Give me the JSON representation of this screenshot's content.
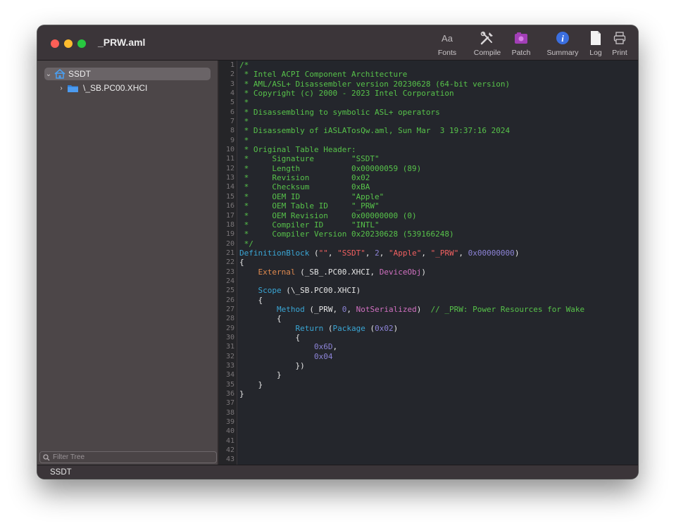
{
  "window": {
    "title": "_PRW.aml"
  },
  "toolbar": [
    {
      "label": "Fonts",
      "icon": "fonts-icon"
    },
    {
      "label": "Compile",
      "icon": "compile-tools-icon"
    },
    {
      "label": "Patch",
      "icon": "patch-icon"
    },
    {
      "label": "Summary",
      "icon": "info-icon"
    },
    {
      "label": "Log",
      "icon": "log-document-icon"
    },
    {
      "label": "Print",
      "icon": "printer-icon"
    }
  ],
  "fonts_icon_text": "Aa",
  "sidebar": {
    "tree": [
      {
        "label": "SSDT",
        "icon": "house-icon",
        "expanded": true,
        "selected": true
      },
      {
        "label": "\\_SB.PC00.XHCI",
        "icon": "folder-icon",
        "expanded": false,
        "selected": false
      }
    ],
    "filter_placeholder": "Filter Tree"
  },
  "status": {
    "text": "SSDT"
  },
  "colors": {
    "comment": "#57c24a",
    "keyword": "#3aa6d5",
    "string": "#f06060",
    "number": "#8c83d6",
    "external": "#e08a4f",
    "object": "#d070c0"
  },
  "editor": {
    "line_numbers": [
      "1",
      "2",
      "3",
      "4",
      "5",
      "6",
      "7",
      "8",
      "9",
      "10",
      "11",
      "12",
      "13",
      "14",
      "15",
      "16",
      "17",
      "18",
      "19",
      "20",
      "21",
      "22",
      "23",
      "24",
      "25",
      "26",
      "27",
      "28",
      "29",
      "30",
      "31",
      "32",
      "33",
      "34",
      "35",
      "36",
      "37",
      "38",
      "39",
      "40",
      "41",
      "42",
      "43"
    ],
    "lines": [
      [
        {
          "t": "/*",
          "c": "comment"
        }
      ],
      [
        {
          "t": " * Intel ACPI Component Architecture",
          "c": "comment"
        }
      ],
      [
        {
          "t": " * AML/ASL+ Disassembler version 20230628 (64-bit version)",
          "c": "comment"
        }
      ],
      [
        {
          "t": " * Copyright (c) 2000 - 2023 Intel Corporation",
          "c": "comment"
        }
      ],
      [
        {
          "t": " *",
          "c": "comment"
        }
      ],
      [
        {
          "t": " * Disassembling to symbolic ASL+ operators",
          "c": "comment"
        }
      ],
      [
        {
          "t": " *",
          "c": "comment"
        }
      ],
      [
        {
          "t": " * Disassembly of iASLATosQw.aml, Sun Mar  3 19:37:16 2024",
          "c": "comment"
        }
      ],
      [
        {
          "t": " *",
          "c": "comment"
        }
      ],
      [
        {
          "t": " * Original Table Header:",
          "c": "comment"
        }
      ],
      [
        {
          "t": " *     Signature        \"SSDT\"",
          "c": "comment"
        }
      ],
      [
        {
          "t": " *     Length           0x00000059 (89)",
          "c": "comment"
        }
      ],
      [
        {
          "t": " *     Revision         0x02",
          "c": "comment"
        }
      ],
      [
        {
          "t": " *     Checksum         0xBA",
          "c": "comment"
        }
      ],
      [
        {
          "t": " *     OEM ID           \"Apple\"",
          "c": "comment"
        }
      ],
      [
        {
          "t": " *     OEM Table ID     \"_PRW\"",
          "c": "comment"
        }
      ],
      [
        {
          "t": " *     OEM Revision     0x00000000 (0)",
          "c": "comment"
        }
      ],
      [
        {
          "t": " *     Compiler ID      \"INTL\"",
          "c": "comment"
        }
      ],
      [
        {
          "t": " *     Compiler Version 0x20230628 (539166248)",
          "c": "comment"
        }
      ],
      [
        {
          "t": " */",
          "c": "comment"
        }
      ],
      [
        {
          "t": "DefinitionBlock",
          "c": "kw"
        },
        {
          "t": " (",
          "c": "plain"
        },
        {
          "t": "\"\"",
          "c": "str"
        },
        {
          "t": ", ",
          "c": "plain"
        },
        {
          "t": "\"SSDT\"",
          "c": "str"
        },
        {
          "t": ", ",
          "c": "plain"
        },
        {
          "t": "2",
          "c": "num"
        },
        {
          "t": ", ",
          "c": "plain"
        },
        {
          "t": "\"Apple\"",
          "c": "str"
        },
        {
          "t": ", ",
          "c": "plain"
        },
        {
          "t": "\"_PRW\"",
          "c": "str"
        },
        {
          "t": ", ",
          "c": "plain"
        },
        {
          "t": "0x00000000",
          "c": "num"
        },
        {
          "t": ")",
          "c": "plain"
        }
      ],
      [
        {
          "t": "{",
          "c": "plain"
        }
      ],
      [
        {
          "t": "    ",
          "c": "plain"
        },
        {
          "t": "External",
          "c": "ext"
        },
        {
          "t": " (_SB_.PC00.XHCI, ",
          "c": "plain"
        },
        {
          "t": "DeviceObj",
          "c": "pink"
        },
        {
          "t": ")",
          "c": "plain"
        }
      ],
      [
        {
          "t": "",
          "c": "plain"
        }
      ],
      [
        {
          "t": "    ",
          "c": "plain"
        },
        {
          "t": "Scope",
          "c": "kw"
        },
        {
          "t": " (\\_SB.PC00.XHCI)",
          "c": "plain"
        }
      ],
      [
        {
          "t": "    {",
          "c": "plain"
        }
      ],
      [
        {
          "t": "        ",
          "c": "plain"
        },
        {
          "t": "Method",
          "c": "kw"
        },
        {
          "t": " (_PRW, ",
          "c": "plain"
        },
        {
          "t": "0",
          "c": "num"
        },
        {
          "t": ", ",
          "c": "plain"
        },
        {
          "t": "NotSerialized",
          "c": "pink"
        },
        {
          "t": ")  ",
          "c": "plain"
        },
        {
          "t": "// _PRW: Power Resources for Wake",
          "c": "comment"
        }
      ],
      [
        {
          "t": "        {",
          "c": "plain"
        }
      ],
      [
        {
          "t": "            ",
          "c": "plain"
        },
        {
          "t": "Return",
          "c": "kw"
        },
        {
          "t": " (",
          "c": "plain"
        },
        {
          "t": "Package",
          "c": "kw"
        },
        {
          "t": " (",
          "c": "plain"
        },
        {
          "t": "0x02",
          "c": "num"
        },
        {
          "t": ")",
          "c": "plain"
        }
      ],
      [
        {
          "t": "            {",
          "c": "plain"
        }
      ],
      [
        {
          "t": "                ",
          "c": "plain"
        },
        {
          "t": "0x6D",
          "c": "num"
        },
        {
          "t": ",",
          "c": "plain"
        }
      ],
      [
        {
          "t": "                ",
          "c": "plain"
        },
        {
          "t": "0x04",
          "c": "num"
        }
      ],
      [
        {
          "t": "            })",
          "c": "plain"
        }
      ],
      [
        {
          "t": "        }",
          "c": "plain"
        }
      ],
      [
        {
          "t": "    }",
          "c": "plain"
        }
      ],
      [
        {
          "t": "}",
          "c": "plain"
        }
      ],
      [
        {
          "t": "",
          "c": "plain"
        }
      ],
      [
        {
          "t": "",
          "c": "plain"
        }
      ],
      [
        {
          "t": "",
          "c": "plain"
        }
      ],
      [
        {
          "t": "",
          "c": "plain"
        }
      ],
      [
        {
          "t": "",
          "c": "plain"
        }
      ],
      [
        {
          "t": "",
          "c": "plain"
        }
      ],
      [
        {
          "t": "",
          "c": "plain"
        }
      ]
    ]
  }
}
